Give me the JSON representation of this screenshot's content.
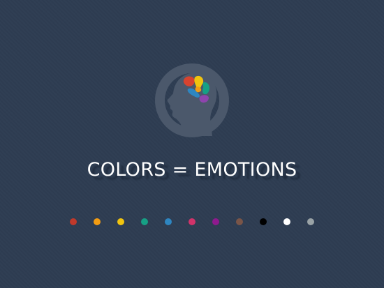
{
  "slide": {
    "title": "COLORS = EMOTIONS"
  },
  "logo": {
    "icon": "head-with-brain-icon",
    "head_color": "#4b586b",
    "brain_colors": [
      "#d7432f",
      "#f1c40f",
      "#f39c12",
      "#16a085",
      "#2e86c1",
      "#8e44ad"
    ]
  },
  "palette": {
    "dots": [
      {
        "name": "red",
        "color": "#c0392b"
      },
      {
        "name": "orange",
        "color": "#f39c12"
      },
      {
        "name": "yellow",
        "color": "#f1c40f"
      },
      {
        "name": "teal",
        "color": "#16a085"
      },
      {
        "name": "blue",
        "color": "#2e86c1"
      },
      {
        "name": "pink",
        "color": "#d1336a"
      },
      {
        "name": "purple",
        "color": "#8e1a8e"
      },
      {
        "name": "brown",
        "color": "#7a5548"
      },
      {
        "name": "black",
        "color": "#000000"
      },
      {
        "name": "white",
        "color": "#ffffff"
      },
      {
        "name": "gray",
        "color": "#9aa3a6"
      }
    ]
  }
}
